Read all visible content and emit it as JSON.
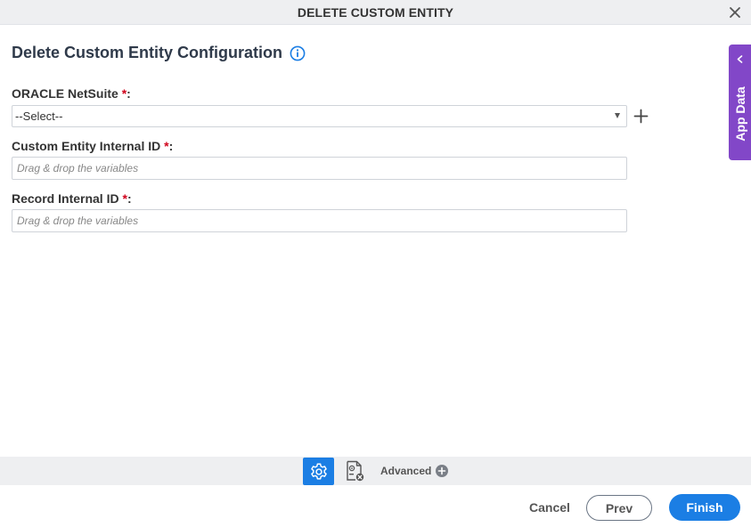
{
  "window": {
    "title": "DELETE CUSTOM ENTITY",
    "close_icon": "close-icon"
  },
  "heading": {
    "title": "Delete Custom Entity Configuration",
    "info_icon": "info-icon"
  },
  "fields": {
    "oracle_netsuite": {
      "label": "ORACLE NetSuite",
      "required_mark": "*",
      "colon": ":",
      "selected_value": "--Select--"
    },
    "custom_entity_internal_id": {
      "label": "Custom Entity Internal ID",
      "required_mark": "*",
      "colon": ":",
      "value": "",
      "placeholder": "Drag & drop the variables"
    },
    "record_internal_id": {
      "label": "Record Internal ID",
      "required_mark": "*",
      "colon": ":",
      "value": "",
      "placeholder": "Drag & drop the variables"
    }
  },
  "side_panel": {
    "label": "App Data",
    "icon": "chevron-left-icon"
  },
  "toolstrip": {
    "settings_icon": "gear-icon",
    "document_icon": "document-settings-icon",
    "advanced_label": "Advanced",
    "advanced_icon": "plus-circle-icon"
  },
  "footer": {
    "cancel_label": "Cancel",
    "prev_label": "Prev",
    "finish_label": "Finish"
  },
  "colors": {
    "accent": "#1b7ee4",
    "side_panel": "#8247c8",
    "required": "#d0021b",
    "bar_background": "#eeeff1"
  }
}
